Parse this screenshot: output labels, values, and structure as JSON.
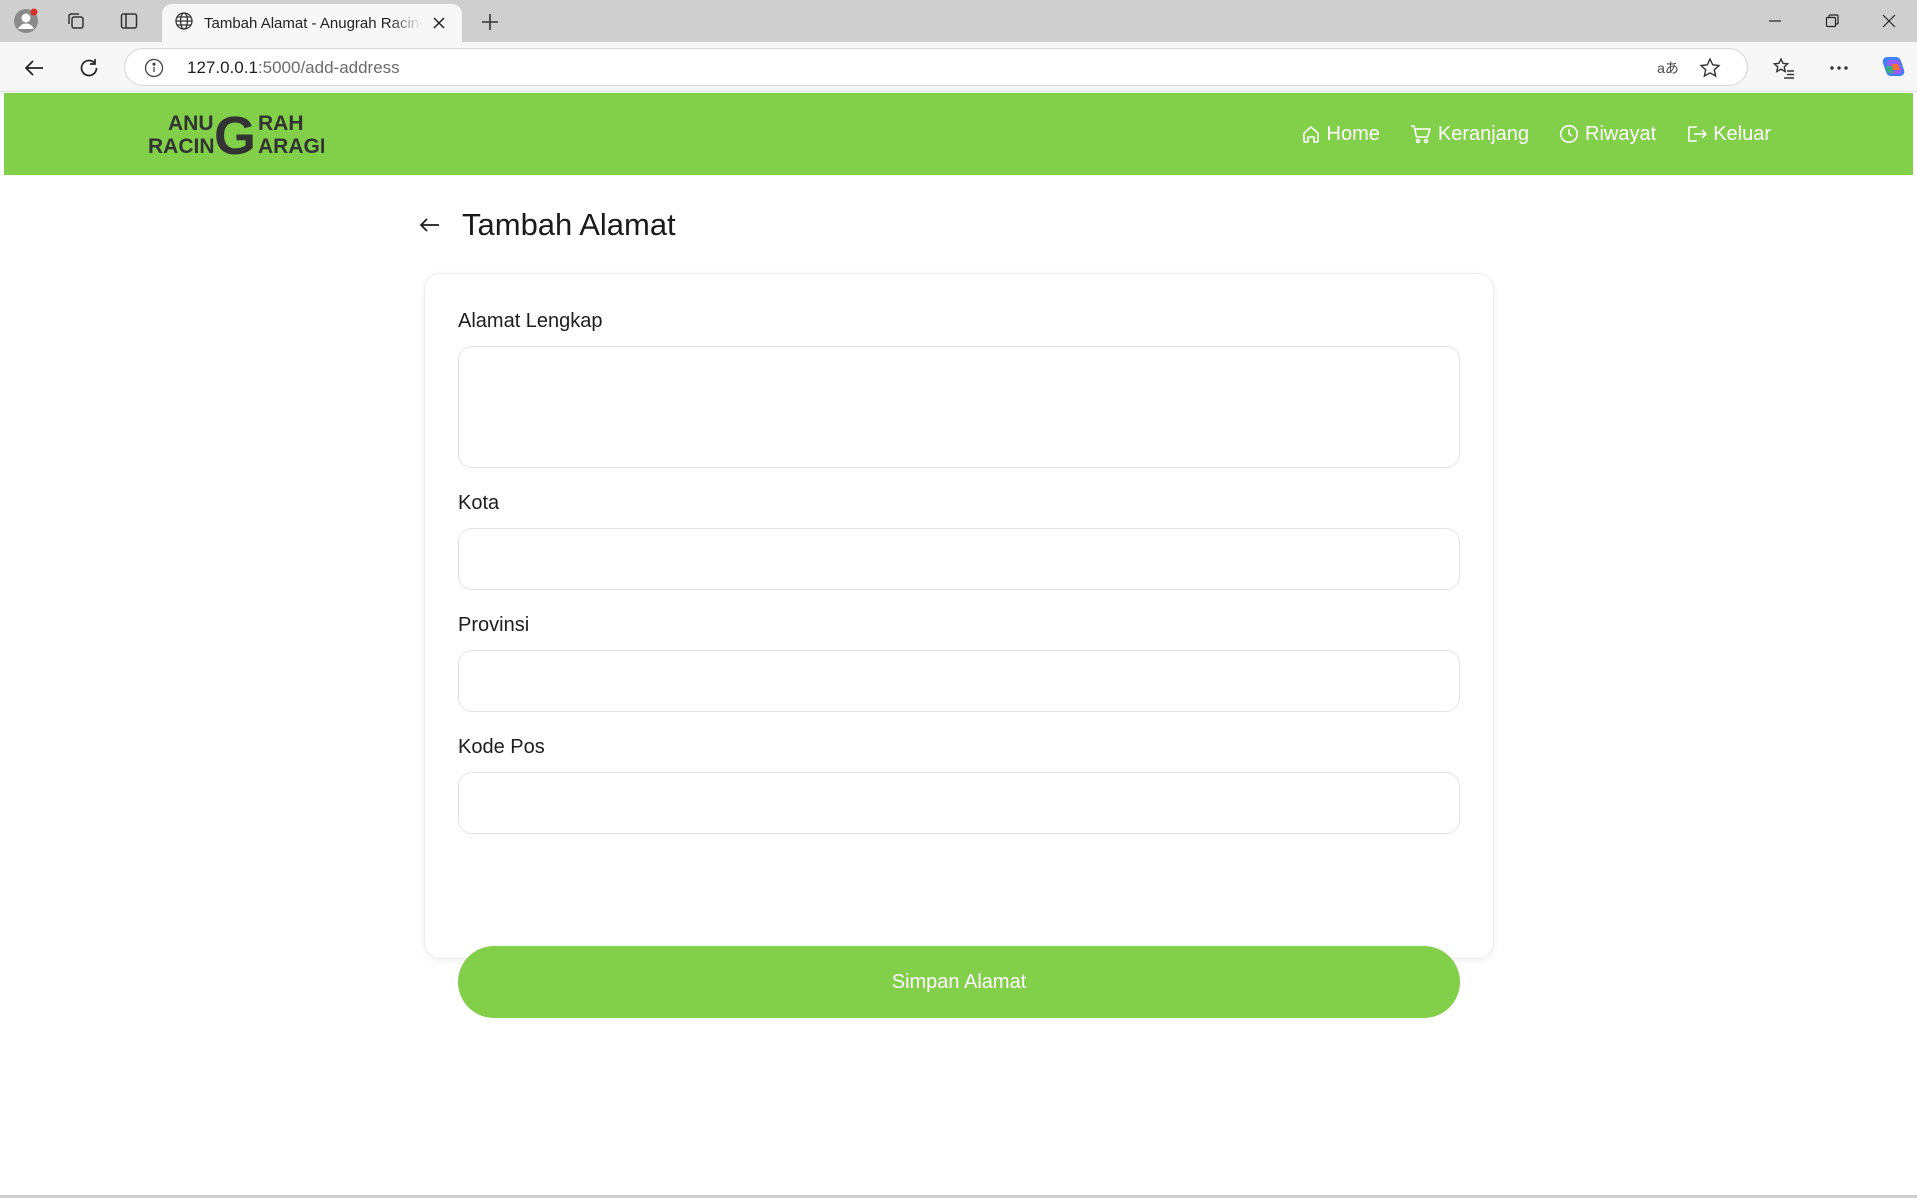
{
  "browser": {
    "tab_title": "Tambah Alamat - Anugrah Racing Garage",
    "url_host": "127.0.0.1",
    "url_path": ":5000/add-address",
    "translate_glyph": "aあ"
  },
  "brand": {
    "line1_left": "ANU",
    "line1_right": "RAH",
    "line2_left": "RACIN",
    "line2_right": "ARAGE",
    "big_letter": "G",
    "color": "#333333"
  },
  "nav": {
    "items": [
      {
        "label": "Home",
        "icon": "home-icon"
      },
      {
        "label": "Keranjang",
        "icon": "cart-icon"
      },
      {
        "label": "Riwayat",
        "icon": "clock-icon"
      },
      {
        "label": "Keluar",
        "icon": "logout-icon"
      }
    ]
  },
  "page": {
    "title": "Tambah Alamat",
    "back_icon": "arrow-left-icon"
  },
  "form": {
    "address_label": "Alamat Lengkap",
    "address_value": "",
    "city_label": "Kota",
    "city_value": "",
    "province_label": "Provinsi",
    "province_value": "",
    "postal_label": "Kode Pos",
    "postal_value": "",
    "submit_label": "Simpan Alamat"
  },
  "colors": {
    "accent": "#82cf4a",
    "text": "#1a1a1a"
  }
}
